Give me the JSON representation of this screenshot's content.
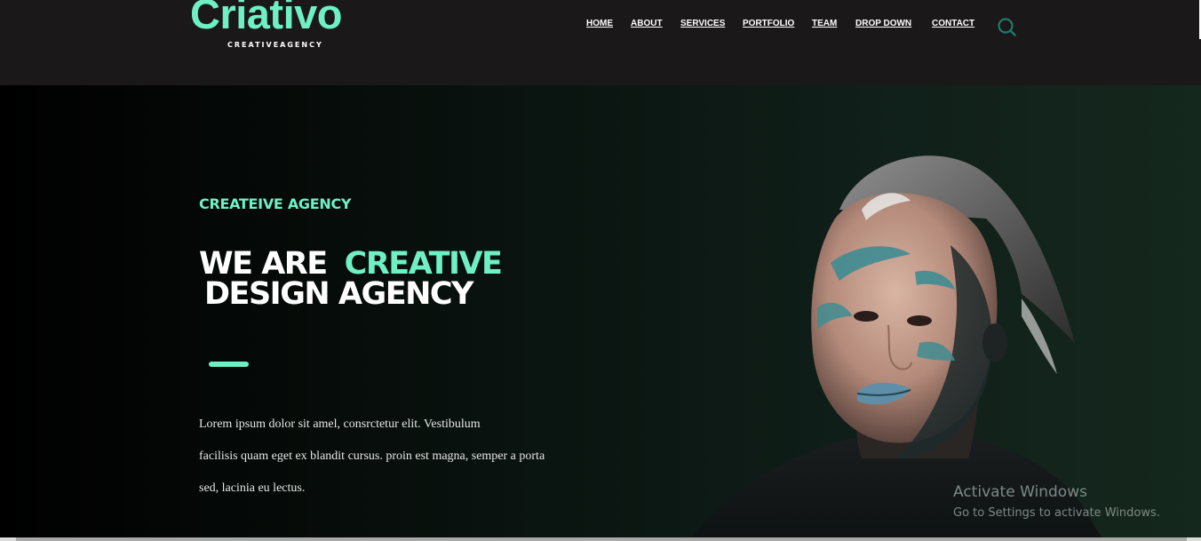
{
  "header": {
    "logo": "Criativo",
    "tagline": "CREATIVEAGENCY",
    "nav": [
      {
        "label": "HOME"
      },
      {
        "label": "ABOUT"
      },
      {
        "label": "SERVICES"
      },
      {
        "label": "PORTFOLIO"
      },
      {
        "label": "TEAM"
      },
      {
        "label": "DROP DOWN"
      },
      {
        "label": "CONTACT"
      }
    ],
    "search_icon": "search-icon"
  },
  "hero": {
    "eyebrow": "CREATEIVE AGENCY",
    "heading_white": "WE ARE",
    "heading_accent": "CREATIVE",
    "heading_line2": "DESIGN AGENCY",
    "body_lines": [
      "Lorem ipsum dolor sit amel, consrctetur elit. Vestibulum",
      "facilisis quam eget ex blandit cursus. proin est magna, semper a porta",
      "sed, lacinia eu lectus."
    ]
  },
  "overlay": {
    "title": "Activate Windows",
    "subtitle": "Go to Settings to activate Windows."
  },
  "colors": {
    "accent": "#6ff0c4",
    "header_bg": "#1a1818",
    "hero_bg_end": "#15281d"
  }
}
